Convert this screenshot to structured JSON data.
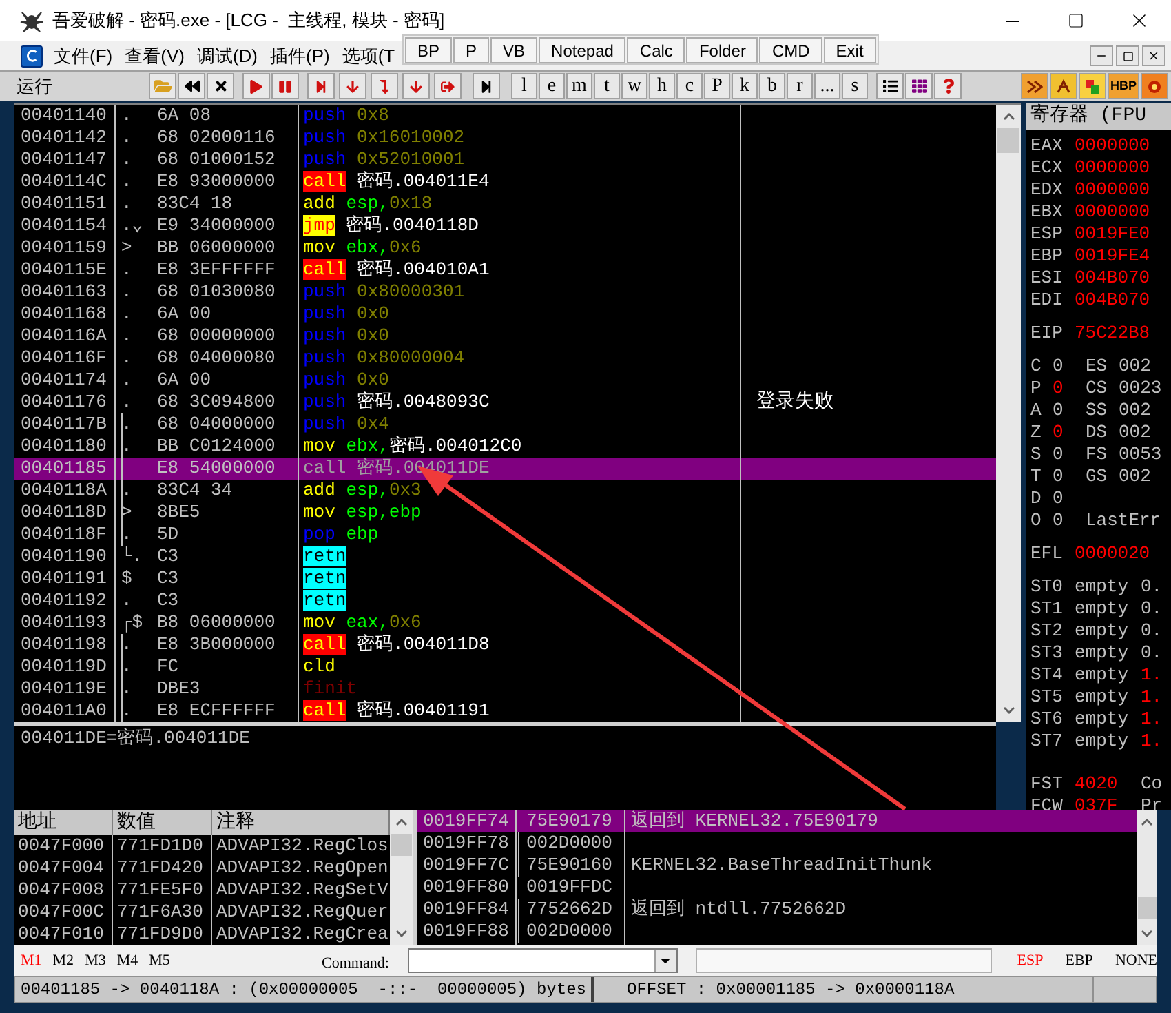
{
  "window": {
    "title": "吾爱破解 - 密码.exe - [LCG -  主线程, 模块 - 密码]"
  },
  "menu": [
    "文件(F)",
    "查看(V)",
    "调试(D)",
    "插件(P)",
    "选项(T"
  ],
  "quick_buttons": [
    "BP",
    "P",
    "VB",
    "Notepad",
    "Calc",
    "Folder",
    "CMD",
    "Exit"
  ],
  "toolbar": {
    "status": "运行",
    "letter_buttons": [
      "l",
      "e",
      "m",
      "t",
      "w",
      "h",
      "c",
      "P",
      "k",
      "b",
      "r",
      "...",
      "s"
    ],
    "tag_button": "HBP"
  },
  "disassembly": {
    "rows": [
      {
        "address": "00401140",
        "marker": ".",
        "hex": "6A 08",
        "mnemonic": "push",
        "kind": "push",
        "operands": [
          {
            "text": "0x8",
            "kind": "imm"
          }
        ],
        "jump_line": false,
        "selected": false
      },
      {
        "address": "00401142",
        "marker": ".",
        "hex": "68 02000116",
        "mnemonic": "push",
        "kind": "push",
        "operands": [
          {
            "text": "0x16010002",
            "kind": "imm"
          }
        ],
        "jump_line": false,
        "selected": false
      },
      {
        "address": "00401147",
        "marker": ".",
        "hex": "68 01000152",
        "mnemonic": "push",
        "kind": "push",
        "operands": [
          {
            "text": "0x52010001",
            "kind": "imm"
          }
        ],
        "jump_line": false,
        "selected": false
      },
      {
        "address": "0040114C",
        "marker": ".",
        "hex": "E8 93000000",
        "mnemonic": "call",
        "kind": "call",
        "operands": [
          {
            "text": "密码.004011E4",
            "kind": "sym"
          }
        ],
        "jump_line": false,
        "selected": false
      },
      {
        "address": "00401151",
        "marker": ".",
        "hex": "83C4 18",
        "mnemonic": "add",
        "kind": "arith",
        "operands": [
          {
            "text": "esp,",
            "kind": "reg"
          },
          {
            "text": "0x18",
            "kind": "imm"
          }
        ],
        "jump_line": false,
        "selected": false
      },
      {
        "address": "00401154",
        "marker": ".⌄",
        "hex": "E9 34000000",
        "mnemonic": "jmp",
        "kind": "jmp",
        "operands": [
          {
            "text": "密码.0040118D",
            "kind": "sym"
          }
        ],
        "jump_line": false,
        "selected": false
      },
      {
        "address": "00401159",
        "marker": ">",
        "hex": "BB 06000000",
        "mnemonic": "mov",
        "kind": "arith",
        "operands": [
          {
            "text": "ebx,",
            "kind": "reg"
          },
          {
            "text": "0x6",
            "kind": "imm"
          }
        ],
        "jump_line": false,
        "selected": false
      },
      {
        "address": "0040115E",
        "marker": ".",
        "hex": "E8 3EFFFFFF",
        "mnemonic": "call",
        "kind": "call",
        "operands": [
          {
            "text": "密码.004010A1",
            "kind": "sym"
          }
        ],
        "jump_line": false,
        "selected": false
      },
      {
        "address": "00401163",
        "marker": ".",
        "hex": "68 01030080",
        "mnemonic": "push",
        "kind": "push",
        "operands": [
          {
            "text": "0x80000301",
            "kind": "imm"
          }
        ],
        "jump_line": false,
        "selected": false
      },
      {
        "address": "00401168",
        "marker": ".",
        "hex": "6A 00",
        "mnemonic": "push",
        "kind": "push",
        "operands": [
          {
            "text": "0x0",
            "kind": "imm"
          }
        ],
        "jump_line": false,
        "selected": false
      },
      {
        "address": "0040116A",
        "marker": ".",
        "hex": "68 00000000",
        "mnemonic": "push",
        "kind": "push",
        "operands": [
          {
            "text": "0x0",
            "kind": "imm"
          }
        ],
        "jump_line": false,
        "selected": false
      },
      {
        "address": "0040116F",
        "marker": ".",
        "hex": "68 04000080",
        "mnemonic": "push",
        "kind": "push",
        "operands": [
          {
            "text": "0x80000004",
            "kind": "imm"
          }
        ],
        "jump_line": false,
        "selected": false
      },
      {
        "address": "00401174",
        "marker": ".",
        "hex": "6A 00",
        "mnemonic": "push",
        "kind": "push",
        "operands": [
          {
            "text": "0x0",
            "kind": "imm"
          }
        ],
        "jump_line": false,
        "selected": false
      },
      {
        "address": "00401176",
        "marker": ".",
        "hex": "68 3C094800",
        "mnemonic": "push",
        "kind": "push",
        "operands": [
          {
            "text": "密码.0048093C",
            "kind": "sym"
          }
        ],
        "comment": "登录失败",
        "jump_line": false,
        "selected": false
      },
      {
        "address": "0040117B",
        "marker": ".",
        "hex": "68 04000000",
        "mnemonic": "push",
        "kind": "push",
        "operands": [
          {
            "text": "0x4",
            "kind": "imm"
          }
        ],
        "jump_line": true,
        "selected": false
      },
      {
        "address": "00401180",
        "marker": ".",
        "hex": "BB C0124000",
        "mnemonic": "mov",
        "kind": "arith",
        "operands": [
          {
            "text": "ebx,",
            "kind": "reg"
          },
          {
            "text": "密码.004012C0",
            "kind": "sym"
          }
        ],
        "jump_line": true,
        "selected": false
      },
      {
        "address": "00401185",
        "hex": "E8 54000000",
        "mnemonic": "call",
        "kind": "call",
        "operands": [
          {
            "text": "密码.004011DE",
            "kind": "sym"
          }
        ],
        "jump_line": true,
        "selected": true
      },
      {
        "address": "0040118A",
        "marker": ".",
        "hex": "83C4 34",
        "mnemonic": "add",
        "kind": "arith",
        "operands": [
          {
            "text": "esp,",
            "kind": "reg"
          },
          {
            "text": "0x3",
            "kind": "imm"
          }
        ],
        "jump_line": true,
        "selected": false
      },
      {
        "address": "0040118D",
        "marker": ">",
        "hex": "8BE5",
        "mnemonic": "mov",
        "kind": "arith",
        "operands": [
          {
            "text": "esp,ebp",
            "kind": "reg"
          }
        ],
        "jump_line": true,
        "selected": false
      },
      {
        "address": "0040118F",
        "marker": ".",
        "hex": "5D",
        "mnemonic": "pop",
        "kind": "pop",
        "operands": [
          {
            "text": "ebp",
            "kind": "reg"
          }
        ],
        "jump_line": true,
        "selected": false
      },
      {
        "address": "00401190",
        "marker": "└.",
        "hex": "C3",
        "mnemonic": "retn",
        "kind": "ret",
        "jump_line": false,
        "selected": false
      },
      {
        "address": "00401191",
        "marker": "$",
        "hex": "C3",
        "mnemonic": "retn",
        "kind": "ret",
        "jump_line": false,
        "selected": false
      },
      {
        "address": "00401192",
        "marker": ".",
        "hex": "C3",
        "mnemonic": "retn",
        "kind": "ret",
        "jump_line": false,
        "selected": false
      },
      {
        "address": "00401193",
        "marker": "┌$",
        "hex": "B8 06000000",
        "mnemonic": "mov",
        "kind": "arith",
        "operands": [
          {
            "text": "eax,",
            "kind": "reg"
          },
          {
            "text": "0x6",
            "kind": "imm"
          }
        ],
        "jump_line": false,
        "selected": false
      },
      {
        "address": "00401198",
        "marker": ".",
        "hex": "E8 3B000000",
        "mnemonic": "call",
        "kind": "call",
        "operands": [
          {
            "text": "密码.004011D8",
            "kind": "sym"
          }
        ],
        "jump_line": true,
        "selected": false
      },
      {
        "address": "0040119D",
        "marker": ".",
        "hex": "FC",
        "mnemonic": "cld",
        "kind": "arith",
        "jump_line": true,
        "selected": false
      },
      {
        "address": "0040119E",
        "marker": ".",
        "hex": "DBE3",
        "mnemonic": "finit",
        "kind": "fpu",
        "jump_line": true,
        "selected": false
      },
      {
        "address": "004011A0",
        "marker": ".",
        "hex": "E8 ECFFFFFF",
        "mnemonic": "call",
        "kind": "call",
        "operands": [
          {
            "text": "密码.00401191",
            "kind": "sym"
          }
        ],
        "jump_line": true,
        "selected": false
      }
    ]
  },
  "info_line": "004011DE=密码.004011DE",
  "registers": {
    "title": "寄存器 (FPU",
    "groups": [
      [
        {
          "kind": "gpr",
          "name": "EAX",
          "value": "0000000"
        },
        {
          "kind": "gpr",
          "name": "ECX",
          "value": "0000000"
        },
        {
          "kind": "gpr",
          "name": "EDX",
          "value": "0000000"
        },
        {
          "kind": "gpr",
          "name": "EBX",
          "value": "0000000"
        },
        {
          "kind": "gpr",
          "name": "ESP",
          "value": "0019FE0"
        },
        {
          "kind": "gpr",
          "name": "EBP",
          "value": "0019FE4"
        },
        {
          "kind": "gpr",
          "name": "ESI",
          "value": "004B070"
        },
        {
          "kind": "gpr",
          "name": "EDI",
          "value": "004B070"
        }
      ],
      [
        {
          "kind": "gpr",
          "name": "EIP",
          "value": "75C22B8"
        }
      ],
      [
        {
          "kind": "flag",
          "name": "C",
          "bit": "0",
          "changed": false,
          "seg": "ES",
          "seg_value": "002"
        },
        {
          "kind": "flag",
          "name": "P",
          "bit": "0",
          "changed": true,
          "seg": "CS",
          "seg_value": "0023"
        },
        {
          "kind": "flag",
          "name": "A",
          "bit": "0",
          "changed": false,
          "seg": "SS",
          "seg_value": "002"
        },
        {
          "kind": "flag",
          "name": "Z",
          "bit": "0",
          "changed": true,
          "seg": "DS",
          "seg_value": "002"
        },
        {
          "kind": "flag",
          "name": "S",
          "bit": "0",
          "changed": false,
          "seg": "FS",
          "seg_value": "0053"
        },
        {
          "kind": "flag",
          "name": "T",
          "bit": "0",
          "changed": false,
          "seg": "GS",
          "seg_value": "002"
        },
        {
          "kind": "flag",
          "name": "D",
          "bit": "0",
          "changed": false
        },
        {
          "kind": "flag",
          "name": "O",
          "bit": "0",
          "changed": false,
          "seg": "LastErr"
        }
      ],
      [
        {
          "kind": "gpr",
          "name": "EFL",
          "value": "0000020"
        }
      ],
      [
        {
          "kind": "fpu",
          "name": "ST0",
          "tag": "empty",
          "value": "0.",
          "changed": false
        },
        {
          "kind": "fpu",
          "name": "ST1",
          "tag": "empty",
          "value": "0.",
          "changed": false
        },
        {
          "kind": "fpu",
          "name": "ST2",
          "tag": "empty",
          "value": "0.",
          "changed": false
        },
        {
          "kind": "fpu",
          "name": "ST3",
          "tag": "empty",
          "value": "0.",
          "changed": false
        },
        {
          "kind": "fpu",
          "name": "ST4",
          "tag": "empty",
          "value": "1.",
          "changed": true
        },
        {
          "kind": "fpu",
          "name": "ST5",
          "tag": "empty",
          "value": "1.",
          "changed": true
        },
        {
          "kind": "fpu",
          "name": "ST6",
          "tag": "empty",
          "value": "1.",
          "changed": true
        },
        {
          "kind": "fpu",
          "name": "ST7",
          "tag": "empty",
          "value": "1.",
          "changed": true
        }
      ],
      [
        {
          "kind": "ctrl",
          "name": "FST",
          "value": "4020",
          "extra": "Co"
        },
        {
          "kind": "ctrl",
          "name": "FCW",
          "value": "037F",
          "extra": "Pr"
        }
      ]
    ]
  },
  "dump": {
    "columns": [
      "地址",
      "数值",
      "注释"
    ],
    "rows": [
      {
        "address": "0047F000",
        "value": "771FD1D0",
        "comment": "ADVAPI32.RegClos"
      },
      {
        "address": "0047F004",
        "value": "771FD420",
        "comment": "ADVAPI32.RegOpen"
      },
      {
        "address": "0047F008",
        "value": "771FE5F0",
        "comment": "ADVAPI32.RegSetV"
      },
      {
        "address": "0047F00C",
        "value": "771F6A30",
        "comment": "ADVAPI32.RegQuer"
      },
      {
        "address": "0047F010",
        "value": "771FD9D0",
        "comment": "ADVAPI32.RegCrea"
      }
    ]
  },
  "stack": {
    "rows": [
      {
        "address": "0019FF74",
        "value": "75E90179",
        "comment": "返回到 KERNEL32.75E90179",
        "jump_line": false,
        "selected": true
      },
      {
        "address": "0019FF78",
        "value": "002D0000",
        "jump_line": true,
        "selected": false
      },
      {
        "address": "0019FF7C",
        "value": "75E90160",
        "comment": "KERNEL32.BaseThreadInitThunk",
        "jump_line": true,
        "selected": false
      },
      {
        "address": "0019FF80",
        "value": "0019FFDC",
        "jump_line": false,
        "selected": false
      },
      {
        "address": "0019FF84",
        "value": "7752662D",
        "comment": "返回到 ntdll.7752662D",
        "jump_line": true,
        "selected": false
      },
      {
        "address": "0019FF88",
        "value": "002D0000",
        "jump_line": true,
        "selected": false
      }
    ]
  },
  "command_bar": {
    "markers": [
      {
        "label": "M1",
        "selected": true
      },
      {
        "label": "M2",
        "selected": false
      },
      {
        "label": "M3",
        "selected": false
      },
      {
        "label": "M4",
        "selected": false
      },
      {
        "label": "M5",
        "selected": false
      }
    ],
    "command_label": "Command:",
    "stack_modes": [
      {
        "label": "ESP",
        "selected": true
      },
      {
        "label": "EBP",
        "selected": false
      },
      {
        "label": "NONE",
        "selected": false
      }
    ]
  },
  "status_bar": [
    "00401185 -> 0040118A : (0x00000005  -::-  00000005) bytes",
    "OFFSET : 0x00001185 -> 0x0000118A"
  ]
}
